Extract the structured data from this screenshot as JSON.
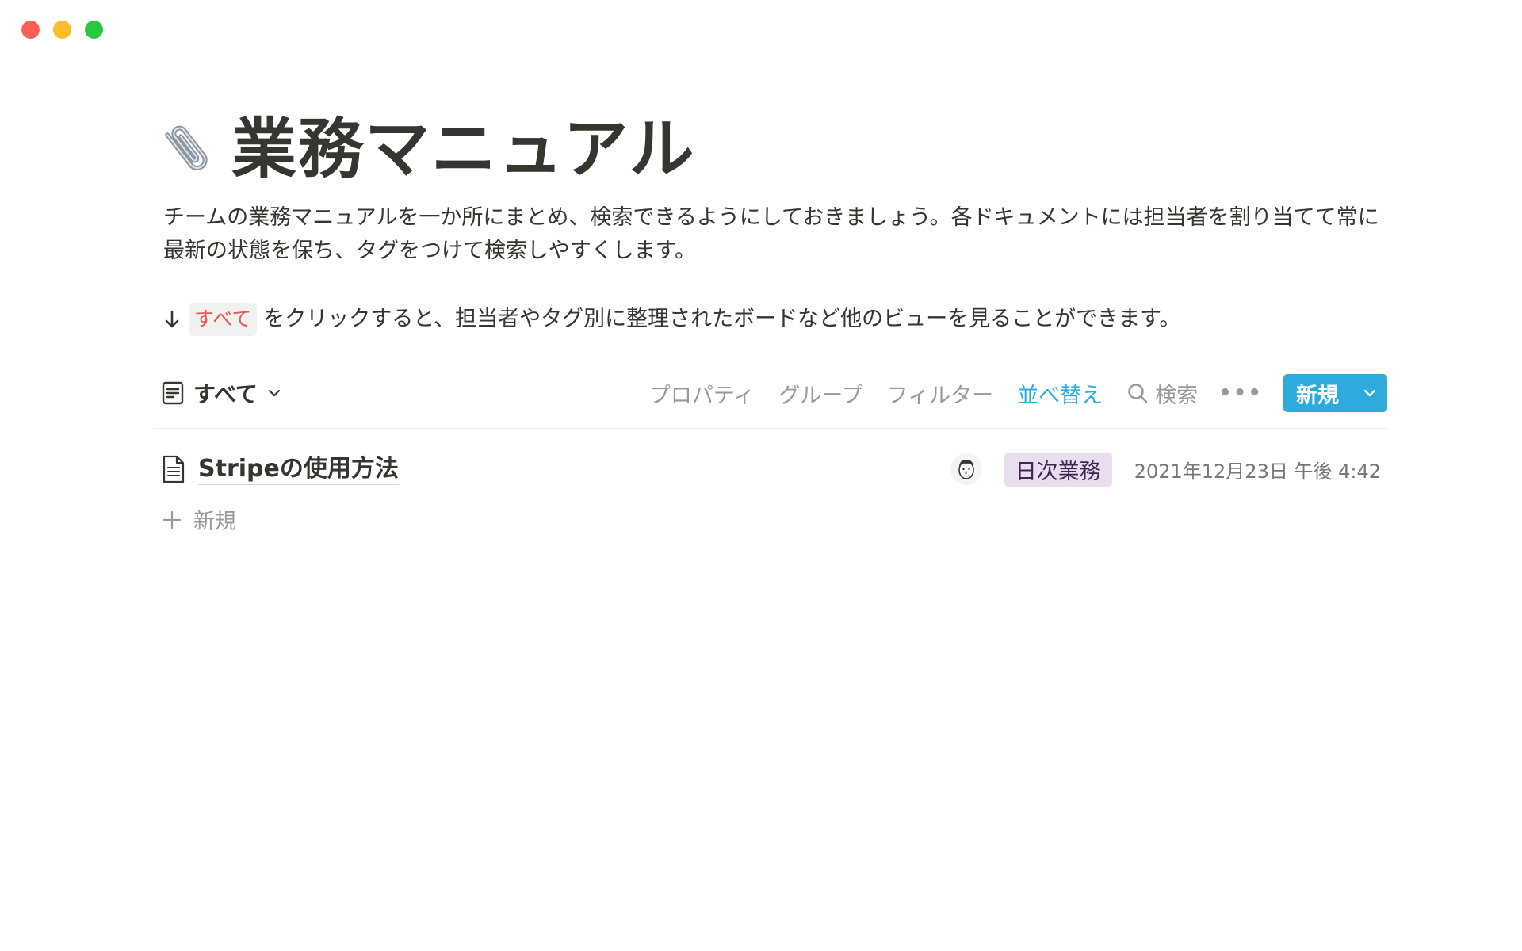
{
  "page": {
    "title": "業務マニュアル",
    "title_icon": "paperclip-icon",
    "description": "チームの業務マニュアルを一か所にまとめ、検索できるようにしておきましょう。各ドキュメントには担当者を割り当てて常に最新の状態を保ち、タグをつけて検索しやすくします。",
    "hint": {
      "arrow_icon": "arrow-down-icon",
      "code": "すべて",
      "text": "をクリックすると、担当者やタグ別に整理されたボードなど他のビューを見ることができます。"
    }
  },
  "database": {
    "view": {
      "icon": "list-view-icon",
      "label": "すべて"
    },
    "toolbar": {
      "properties": "プロパティ",
      "group": "グループ",
      "filter": "フィルター",
      "sort": "並べ替え",
      "search": "検索",
      "more": "•••",
      "new": "新規"
    },
    "rows": [
      {
        "title": "Stripeの使用方法",
        "tag": "日次業務",
        "date": "2021年12月23日 午後 4:42"
      }
    ],
    "add_row": "新規"
  },
  "colors": {
    "accent": "#2eaadc",
    "text": "#37352f",
    "muted": "#9b9a97",
    "tag_bg": "#e8deee",
    "code_text": "#eb5757"
  }
}
